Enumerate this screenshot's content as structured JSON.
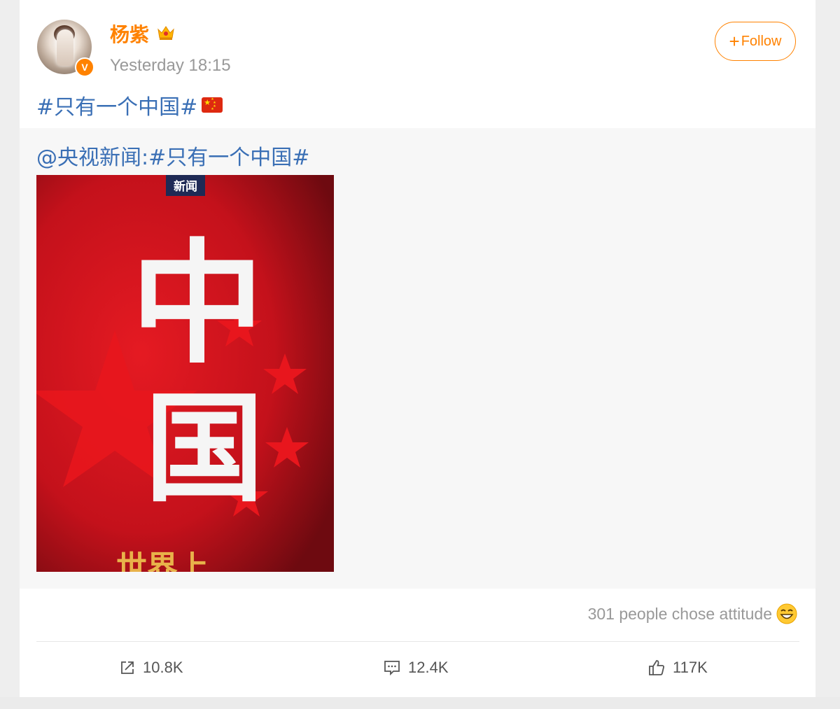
{
  "post": {
    "username": "杨紫",
    "timestamp": "Yesterday 18:15",
    "follow_label": "Follow",
    "text": "#只有一个中国#",
    "repost_text": "@央视新闻:#只有一个中国#",
    "image": {
      "badge_text": "新闻",
      "main_characters": "中国",
      "bottom_text": "世界上"
    },
    "attitude_text": "301 people chose attitude",
    "actions": {
      "share_count": "10.8K",
      "comment_count": "12.4K",
      "like_count": "117K"
    }
  },
  "colors": {
    "brand": "#ff8200",
    "link": "#3a6fb5",
    "muted": "#999999",
    "poster_red": "#c4111b"
  },
  "icons": [
    "verified-badge-icon",
    "crown-icon",
    "plus-icon",
    "china-flag-icon",
    "laughing-emoji-icon",
    "share-icon",
    "comment-icon",
    "like-icon"
  ]
}
